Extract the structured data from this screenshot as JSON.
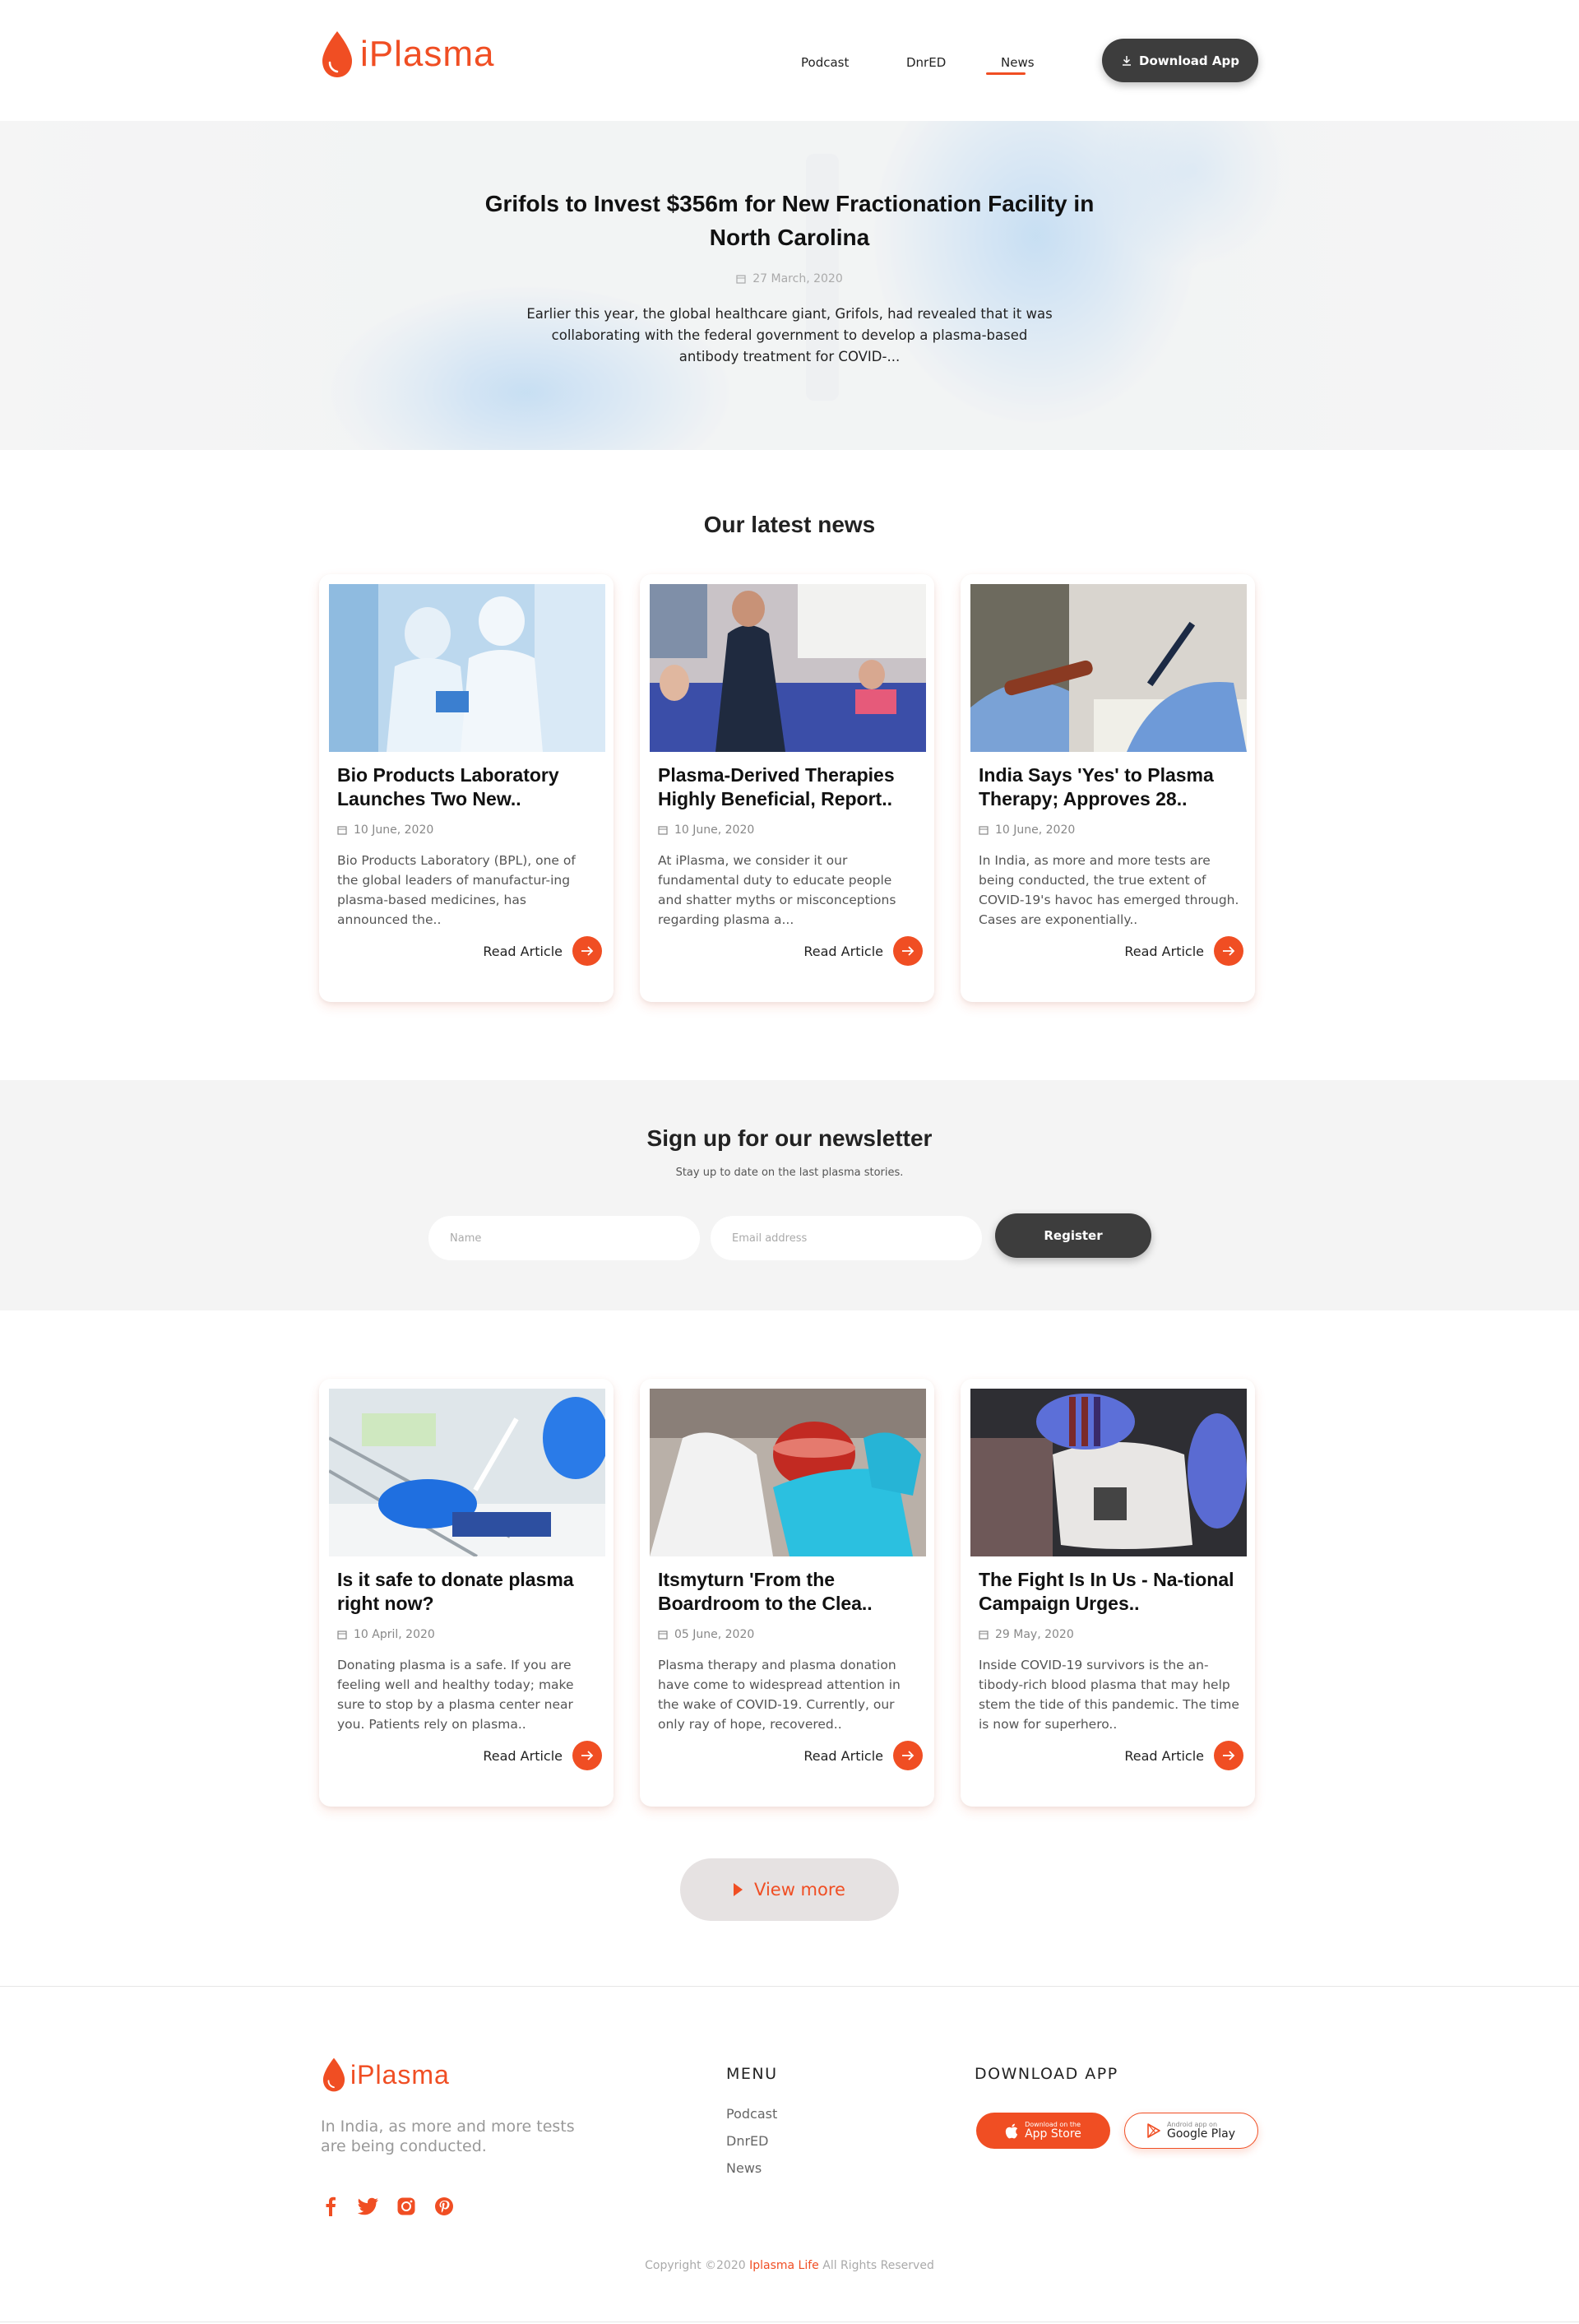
{
  "brand": {
    "name": "iPlasma",
    "accent": "#f04e23"
  },
  "nav": {
    "items": [
      {
        "label": "Podcast"
      },
      {
        "label": "DnrED"
      },
      {
        "label": "News"
      }
    ],
    "active": "News",
    "download_label": "Download App"
  },
  "hero": {
    "title": "Grifols to Invest $356m for New Fractionation Facility in North Carolina",
    "date": "27 March, 2020",
    "excerpt": "Earlier this year, the global healthcare giant, Grifols, had revealed that it was collaborating with the federal government to develop a plasma-based antibody treatment for COVID-..."
  },
  "latest": {
    "title": "Our latest news",
    "read_label": "Read Article",
    "cards": [
      {
        "title": "Bio Products Laboratory Launches Two New..",
        "date": "10 June, 2020",
        "excerpt": "Bio Products Laboratory (BPL), one of the global leaders of manufactur-ing plasma-based medicines, has announced the.."
      },
      {
        "title": "Plasma-Derived Therapies Highly Beneficial, Report..",
        "date": "10 June, 2020",
        "excerpt": "At iPlasma, we consider it our fundamental duty to educate people and shatter myths or misconceptions regarding plasma a..."
      },
      {
        "title": "India Says 'Yes' to Plasma Therapy; Approves 28..",
        "date": "10 June, 2020",
        "excerpt": "In India, as more and more tests are being conducted, the true extent of COVID-19's havoc has emerged through. Cases are exponentially.."
      }
    ]
  },
  "newsletter": {
    "title": "Sign up for our newsletter",
    "subtitle": "Stay up to date on the last plasma stories.",
    "name_placeholder": "Name",
    "email_placeholder": "Email address",
    "register_label": "Register"
  },
  "more": {
    "read_label": "Read Article",
    "cards": [
      {
        "title": "Is it safe to donate plasma right now?",
        "date": "10 April, 2020",
        "excerpt": "Donating plasma is a safe. If you are feeling well and healthy today; make sure to stop by a plasma center near you. Patients rely on plasma.."
      },
      {
        "title": "Itsmyturn 'From the Boardroom to the Clea..",
        "date": "05 June, 2020",
        "excerpt": "Plasma therapy and plasma donation have come to widespread attention in the wake of COVID-19. Currently, our only ray of hope, recovered.."
      },
      {
        "title": "The Fight Is In Us - Na-tional Campaign Urges..",
        "date": "29 May, 2020",
        "excerpt": "Inside COVID-19 survivors is the an-tibody-rich blood plasma that may help stem the tide of this pandemic. The time is now for superhero.."
      }
    ],
    "view_more_label": "View more"
  },
  "footer": {
    "description": "In India, as more and more tests are being conducted.",
    "menu_title": "MENU",
    "menu_items": [
      "Podcast",
      "DnrED",
      "News"
    ],
    "download_title": "DOWNLOAD APP",
    "appstore_small": "Download on the",
    "appstore_big": "App Store",
    "google_small": "Android app on",
    "google_big": "Google Play",
    "social_icons": [
      "facebook-icon",
      "twitter-icon",
      "instagram-icon",
      "pinterest-icon"
    ],
    "copyright_prefix": "Copyright ©2020",
    "copyright_brand": "Iplasma Life",
    "copyright_suffix": "All Rights Reserved"
  }
}
